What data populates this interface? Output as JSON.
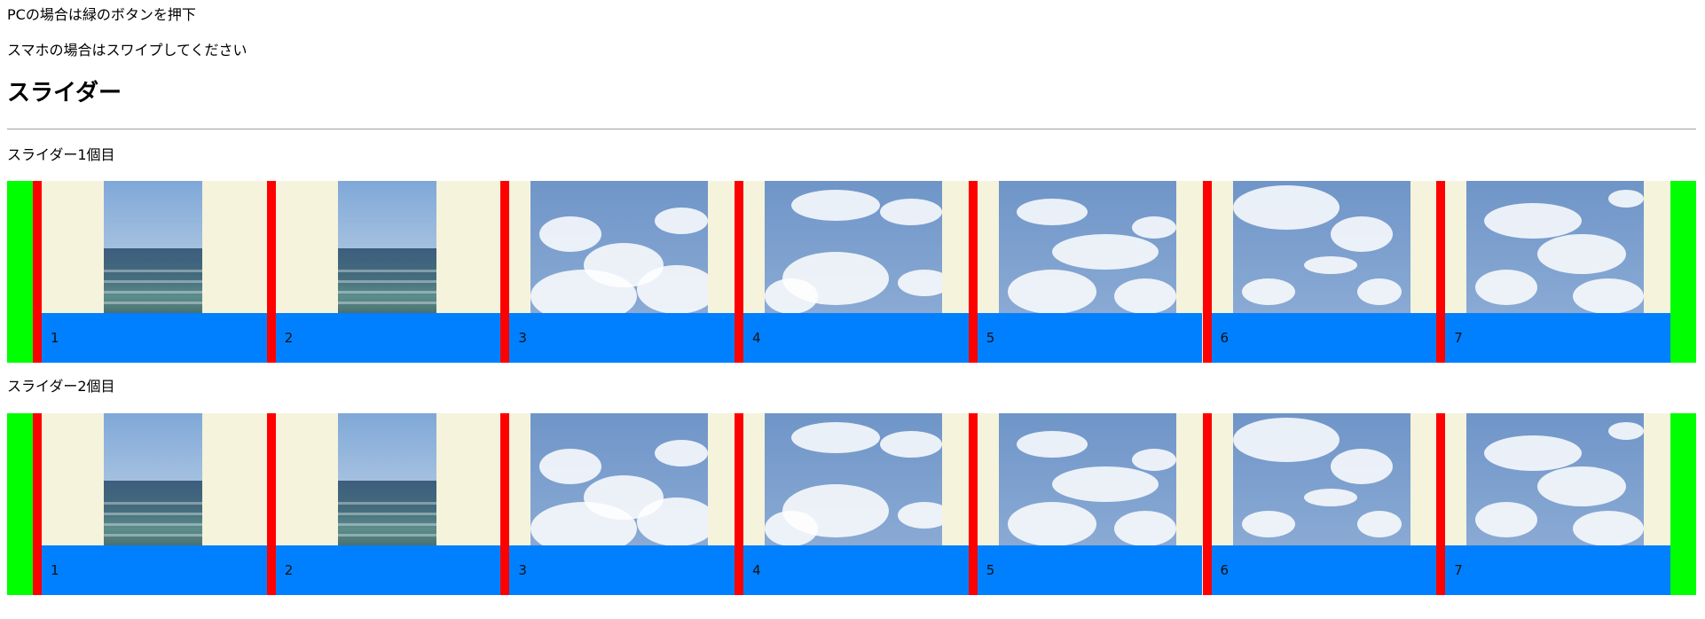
{
  "instructions": {
    "pc": "PCの場合は緑のボタンを押下",
    "mobile": "スマホの場合はスワイプしてください"
  },
  "heading": "スライダー",
  "sliders": [
    {
      "label": "スライダー1個目",
      "slides": [
        {
          "number": "1",
          "image": "sea"
        },
        {
          "number": "2",
          "image": "sea"
        },
        {
          "number": "3",
          "image": "clouds"
        },
        {
          "number": "4",
          "image": "clouds"
        },
        {
          "number": "5",
          "image": "clouds"
        },
        {
          "number": "6",
          "image": "clouds"
        },
        {
          "number": "7",
          "image": "clouds"
        }
      ]
    },
    {
      "label": "スライダー2個目",
      "slides": [
        {
          "number": "1",
          "image": "sea"
        },
        {
          "number": "2",
          "image": "sea"
        },
        {
          "number": "3",
          "image": "clouds"
        },
        {
          "number": "4",
          "image": "clouds"
        },
        {
          "number": "5",
          "image": "clouds"
        },
        {
          "number": "6",
          "image": "clouds"
        },
        {
          "number": "7",
          "image": "clouds"
        }
      ]
    }
  ],
  "colors": {
    "nav_button": "#00ff00",
    "slide_divider": "#ff0000",
    "caption_bar": "#0080ff",
    "slide_background": "#f5f3dc"
  }
}
